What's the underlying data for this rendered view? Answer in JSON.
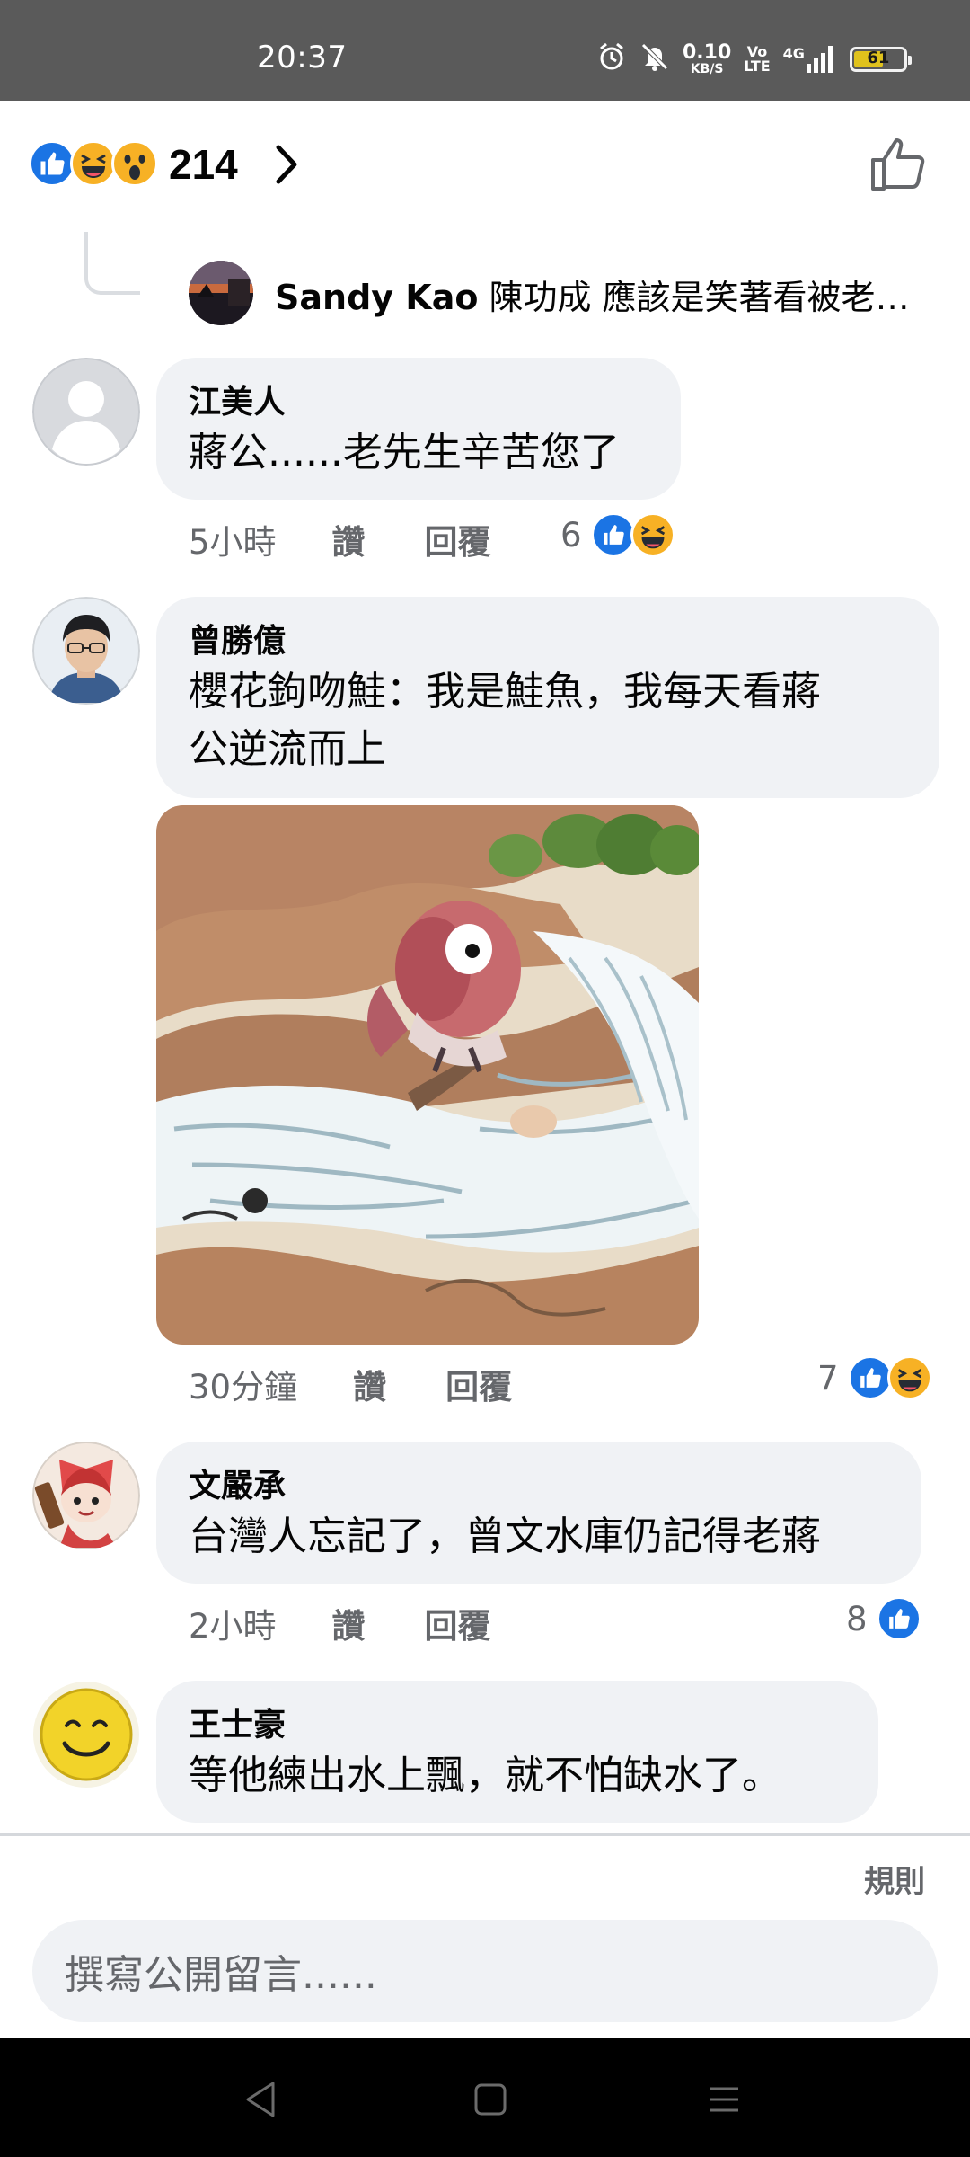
{
  "status_bar": {
    "time": "20:37",
    "speed_value": "0.10",
    "speed_unit": "KB/S",
    "volte_top": "Vo",
    "volte_bottom": "LTE",
    "network": "4G",
    "battery": "61",
    "battery_level_percent": 61,
    "icons": [
      "alarm-icon",
      "mute-icon",
      "signal-icon",
      "battery-icon"
    ]
  },
  "reactions_header": {
    "count": "214",
    "icons": [
      "like-reaction-icon",
      "haha-reaction-icon",
      "wow-reaction-icon"
    ],
    "like_button_icon": "thumbs-up-outline-icon"
  },
  "previous_reply": {
    "name": "Sandy Kao",
    "text": "陳功成 應該是笑著看被老美..."
  },
  "comments": [
    {
      "name": "江美人",
      "text": "蔣公......老先生辛苦您了",
      "time": "5小時",
      "like_label": "讚",
      "reply_label": "回覆",
      "reaction_count": "6",
      "reactions": [
        "like",
        "haha"
      ]
    },
    {
      "name": "曾勝億",
      "text_line1": "櫻花鉤吻鮭：我是鮭魚，我每天看蔣",
      "text_line2": "公逆流而上",
      "time": "30分鐘",
      "like_label": "讚",
      "reply_label": "回覆",
      "reaction_count": "7",
      "reactions": [
        "like",
        "haha"
      ],
      "image": "cartoon-salmon-river"
    },
    {
      "name": "文嚴承",
      "text": "台灣人忘記了，曾文水庫仍記得老蔣",
      "time": "2小時",
      "like_label": "讚",
      "reply_label": "回覆",
      "reaction_count": "8",
      "reactions": [
        "like"
      ]
    },
    {
      "name": "王士豪",
      "text": "等他練出水上飄，就不怕缺水了。"
    }
  ],
  "footer": {
    "rules_label": "規則",
    "input_placeholder": "撰寫公開留言......"
  },
  "colors": {
    "accent": "#1b74e4",
    "bubble": "#f0f2f5",
    "meta_text": "#65676b",
    "status_bar": "#5a5a5a"
  }
}
